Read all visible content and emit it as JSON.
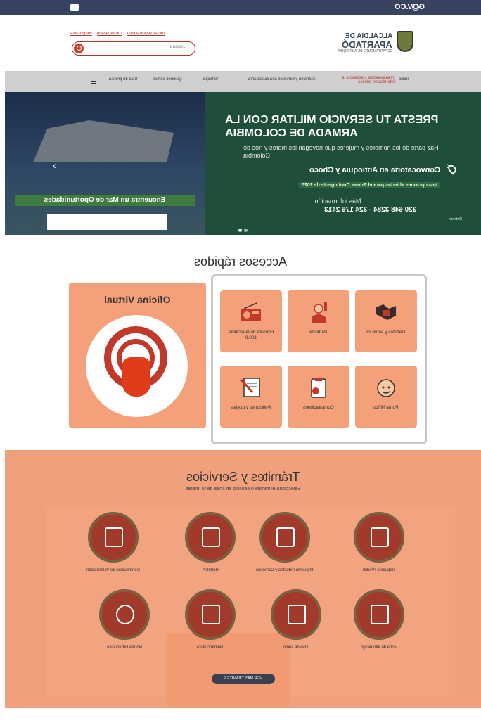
{
  "topbar": {
    "gov_label": "GOV.CO"
  },
  "header": {
    "logo_line1": "ALCALDÍA DE",
    "logo_line2": "APARTADÓ",
    "logo_line3": "DEPARTAMENTO DE ANTIOQUIA",
    "links": [
      "Iniciar sesión admin",
      "Iniciar sesión",
      "Registrarse"
    ],
    "search_placeholder": "Buscar..."
  },
  "nav": {
    "items": [
      "Inicio",
      "Transparencia y acceso a la información pública",
      "Atención y servicios a la ciudadanía",
      "Participa",
      "Quiénes somos",
      "Sala de prensa"
    ]
  },
  "banner": {
    "headline": "PRESTA TU SERVICIO MILITAR CON LA ARMADA DE COLOMBIA",
    "sub": "Haz parte de los hombres y mujeres que navegan los mares y ríos de Colombia",
    "convocatoria": "Convocatoria en Antioquia y Chocó",
    "inscripciones": "Inscripciones abiertas para el Primer Contingente de 2025",
    "mas_info": "Más información:",
    "phones": "320 648 3284 - 324 176 2413",
    "encuentra": "Encuentra un Mar de Oportunidades",
    "pause": "Detener"
  },
  "accesos": {
    "title": "Accesos rápidos",
    "oficina_title": "Oficina Virtual",
    "tiles": [
      {
        "label": "Trámites y servicios",
        "icon": "handshake-icon"
      },
      {
        "label": "Participa",
        "icon": "raised-hand-icon"
      },
      {
        "label": "Emisora de la Alcaldía 100.9",
        "icon": "radio-icon"
      },
      {
        "label": "Portal Niños",
        "icon": "child-face-icon"
      },
      {
        "label": "Contrataciones",
        "icon": "clipboard-icon"
      },
      {
        "label": "Peticiones y quejas",
        "icon": "document-pen-icon"
      }
    ]
  },
  "tramites": {
    "title": "Trámites y Servicios",
    "subtitle": "Selecciona el trámite o servicio en línea de tu interés",
    "items": [
      {
        "label": "Impuesto Predial",
        "icon": "house-icon"
      },
      {
        "label": "Impuesto Industria y Comercio",
        "icon": "building-icon"
      },
      {
        "label": "ReteICA",
        "icon": "receipt-icon"
      },
      {
        "label": "Contribución de Valorización",
        "icon": "certificate-icon"
      },
      {
        "label": "Zona de alto riesgo",
        "icon": "checklist-icon"
      },
      {
        "label": "Uso de suelo",
        "icon": "land-icon"
      },
      {
        "label": "Nomenclatura",
        "icon": "document-icon"
      },
      {
        "label": "Norma Urbanística",
        "icon": "registered-icon"
      }
    ],
    "ver_mas": "VER MÁS TRÁMITES"
  }
}
